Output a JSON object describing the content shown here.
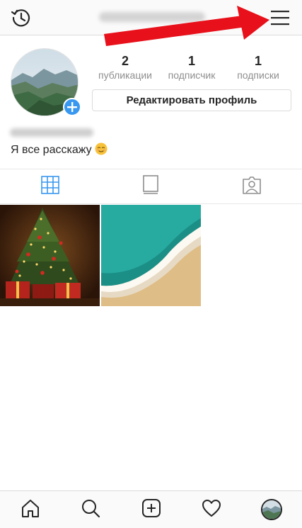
{
  "topbar": {
    "history_icon": "history-icon",
    "username_blurred": "",
    "menu_icon": "menu-icon"
  },
  "profile": {
    "stats": [
      {
        "value": "2",
        "label": "публикации"
      },
      {
        "value": "1",
        "label": "подписчик"
      },
      {
        "value": "1",
        "label": "подписки"
      }
    ],
    "edit_button": "Редактировать профиль",
    "full_name_blurred": "",
    "bio": "Я все расскажу"
  },
  "tabs": [
    {
      "icon": "grid-icon",
      "active": true
    },
    {
      "icon": "feed-icon",
      "active": false
    },
    {
      "icon": "tagged-icon",
      "active": false
    }
  ],
  "posts": [
    {
      "subject": "christmas-tree"
    },
    {
      "subject": "ocean-beach"
    }
  ],
  "bottom_nav": [
    {
      "icon": "home-icon"
    },
    {
      "icon": "search-icon"
    },
    {
      "icon": "add-post-icon"
    },
    {
      "icon": "heart-icon"
    },
    {
      "icon": "profile-avatar"
    }
  ],
  "colors": {
    "accent": "#3897f0",
    "arrow": "#e8101a",
    "text": "#262626",
    "muted": "#8e8e8e",
    "border": "#dbdbdb"
  }
}
